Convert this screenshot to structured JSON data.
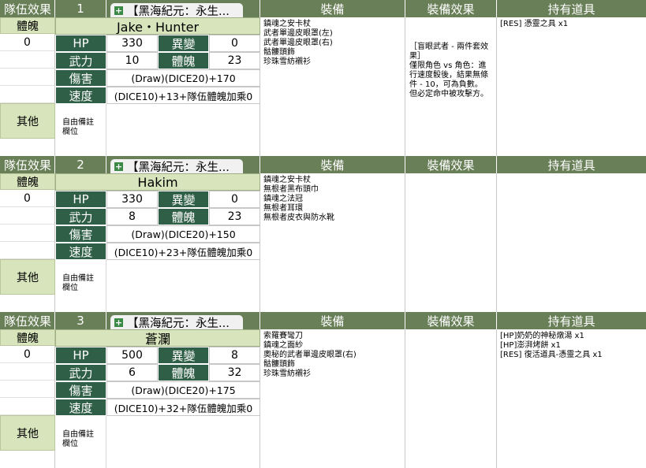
{
  "teams": [
    {
      "team_effect_label": "隊伍效果",
      "index": "1",
      "tab_title": "【黑海紀元：永生...",
      "equipment_header": "裝備",
      "equip_effect_header": "裝備效果",
      "items_header": "持有道具",
      "soul_label": "體魄",
      "soul_value": "0",
      "other_label": "其他",
      "note_label": "自由備註\n欄位",
      "name": "Jake・Hunter",
      "hp_label": "HP",
      "hp": "330",
      "mutation_label": "異變",
      "mutation": "0",
      "power_label": "武力",
      "power": "10",
      "body_label": "體魄",
      "body": "23",
      "damage_label": "傷害",
      "damage": "(Draw)(DICE20)+170",
      "speed_label": "速度",
      "speed": "(DICE10)+13+隊伍體魄加乘0",
      "equipment": "鎮魂之安卡杖\n武者單邊皮眼罩(左)\n武者單邊皮眼罩(右)\n骷髏頭飾\n珍珠雪紡襯衫",
      "equip_effect": "［盲眼武者 - 兩件套效果］\n僅限角色 vs 角色：進行速度骰後，結果無條件 - 10，可為負數。\n但必定命中被攻擊方。",
      "items": "[RES] 憑靈之具 x1"
    },
    {
      "team_effect_label": "隊伍效果",
      "index": "2",
      "tab_title": "【黑海紀元：永生...",
      "equipment_header": "裝備",
      "equip_effect_header": "裝備效果",
      "items_header": "持有道具",
      "soul_label": "體魄",
      "soul_value": "0",
      "other_label": "其他",
      "note_label": "自由備註\n欄位",
      "name": "Hakim",
      "hp_label": "HP",
      "hp": "330",
      "mutation_label": "異變",
      "mutation": "0",
      "power_label": "武力",
      "power": "8",
      "body_label": "體魄",
      "body": "23",
      "damage_label": "傷害",
      "damage": "(Draw)(DICE20)+150",
      "speed_label": "速度",
      "speed": "(DICE10)+23+隊伍體魄加乘0",
      "equipment": "鎮魂之安卡杖\n無根者黑布頭巾\n鎮魂之法冠\n無根者耳環\n無根者皮衣與防水靴",
      "equip_effect": "",
      "items": ""
    },
    {
      "team_effect_label": "隊伍效果",
      "index": "3",
      "tab_title": "【黑海紀元：永生...",
      "equipment_header": "裝備",
      "equip_effect_header": "裝備效果",
      "items_header": "持有道具",
      "soul_label": "體魄",
      "soul_value": "0",
      "other_label": "其他",
      "note_label": "自由備註\n欄位",
      "name": "蒼瀾",
      "hp_label": "HP",
      "hp": "500",
      "mutation_label": "異變",
      "mutation": "8",
      "power_label": "武力",
      "power": "6",
      "body_label": "體魄",
      "body": "32",
      "damage_label": "傷害",
      "damage": "(Draw)(DICE20)+175",
      "speed_label": "速度",
      "speed": "(DICE10)+32+隊伍體魄加乘0",
      "equipment": "索羅賽彎刀\n鎮魂之面紗\n奧秘的武者單邊皮眼罩(右)\n骷髏頭飾\n珍珠雪紡襯衫",
      "equip_effect": "",
      "items": "[HP]奶奶的神秘燉湯 x1\n[HP]澎湃烤餅 x1\n[RES] 復活道具-憑靈之具 x1"
    }
  ],
  "colors": {
    "header_green": "#687f57",
    "dark_green": "#2f5f46",
    "light_green": "#d8e4bc"
  }
}
